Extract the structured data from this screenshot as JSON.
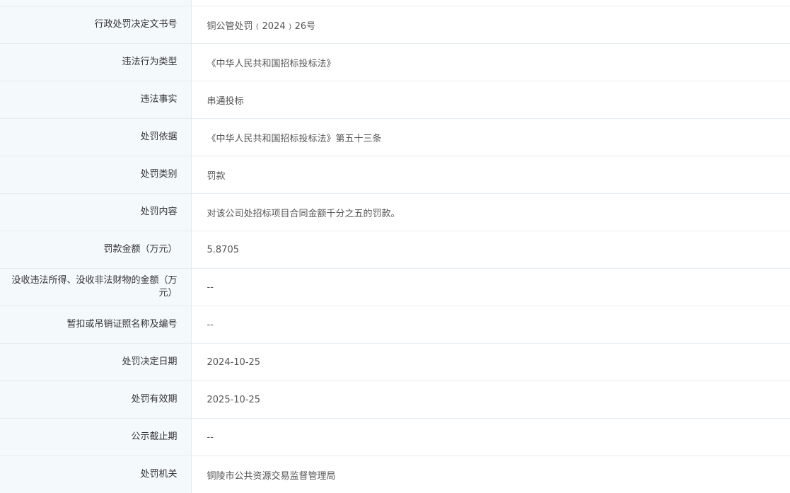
{
  "rows": [
    {
      "label": "行政处罚决定文书号",
      "value": "铜公管处罚﹙2024﹚26号"
    },
    {
      "label": "违法行为类型",
      "value": "《中华人民共和国招标投标法》"
    },
    {
      "label": "违法事实",
      "value": "串通投标"
    },
    {
      "label": "处罚依据",
      "value": "《中华人民共和国招标投标法》第五十三条"
    },
    {
      "label": "处罚类别",
      "value": "罚款"
    },
    {
      "label": "处罚内容",
      "value": "对该公司处招标项目合同金额千分之五的罚款。"
    },
    {
      "label": "罚款金额（万元）",
      "value": "5.8705"
    },
    {
      "label": "没收违法所得、没收非法财物的金额（万元）",
      "value": "--"
    },
    {
      "label": "暂扣或吊销证照名称及编号",
      "value": "--"
    },
    {
      "label": "处罚决定日期",
      "value": "2024-10-25"
    },
    {
      "label": "处罚有效期",
      "value": "2025-10-25"
    },
    {
      "label": "公示截止期",
      "value": "--"
    },
    {
      "label": "处罚机关",
      "value": "铜陵市公共资源交易监督管理局"
    }
  ]
}
